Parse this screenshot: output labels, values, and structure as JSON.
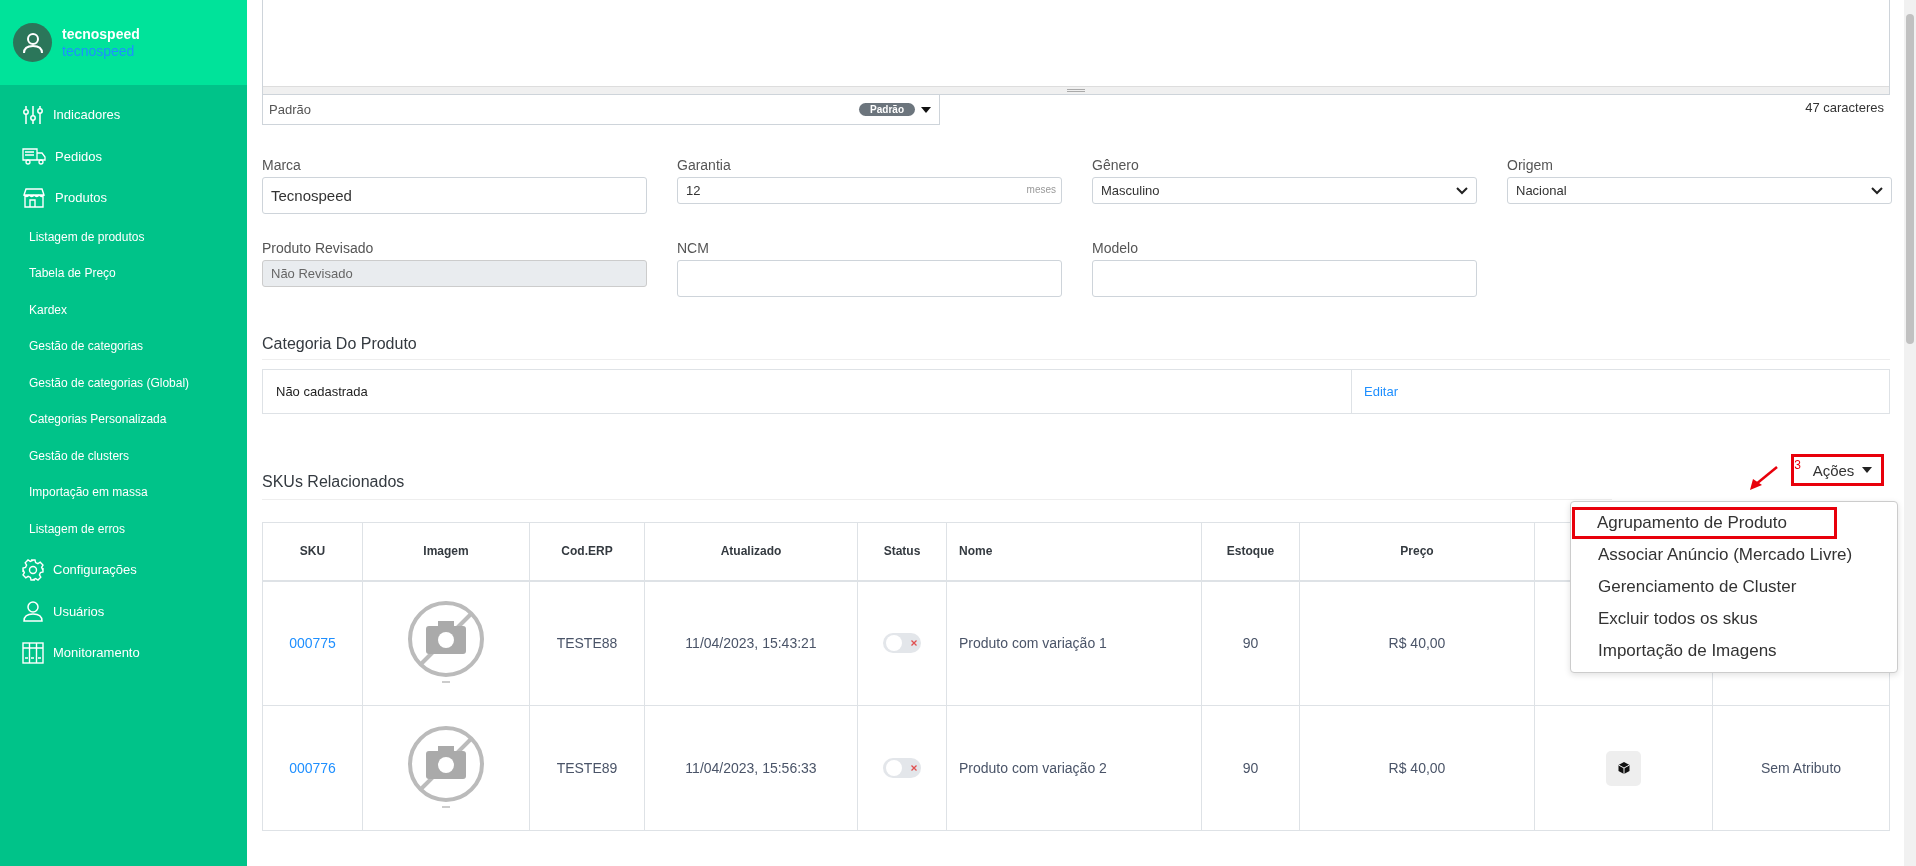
{
  "user": {
    "name": "tecnospeed",
    "company": "tecnospeed"
  },
  "sidebar": {
    "items": [
      {
        "label": "Indicadores"
      },
      {
        "label": "Pedidos"
      },
      {
        "label": "Produtos",
        "children": [
          {
            "label": "Listagem de produtos"
          },
          {
            "label": "Tabela de Preço"
          },
          {
            "label": "Kardex"
          },
          {
            "label": "Gestão de categorias"
          },
          {
            "label": "Gestão de categorias (Global)"
          },
          {
            "label": "Categorias Personalizada"
          },
          {
            "label": "Gestão de clusters"
          },
          {
            "label": "Importação em massa"
          },
          {
            "label": "Listagem de erros"
          }
        ]
      },
      {
        "label": "Configurações"
      },
      {
        "label": "Usuários"
      },
      {
        "label": "Monitoramento"
      }
    ]
  },
  "description": {
    "template": {
      "value": "Padrão",
      "badge": "Padrão"
    },
    "char_count": "47 caracteres"
  },
  "fields": [
    {
      "label": "Marca",
      "value": "Tecnospeed",
      "kind": "text",
      "disabled": false
    },
    {
      "label": "Garantia",
      "value": "12",
      "suffix": "meses",
      "kind": "text",
      "disabled": false
    },
    {
      "label": "Gênero",
      "value": "Masculino",
      "kind": "select",
      "disabled": false
    },
    {
      "label": "Origem",
      "value": "Nacional",
      "kind": "select",
      "disabled": false
    },
    {
      "label": "Produto Revisado",
      "value": "Não Revisado",
      "kind": "text",
      "disabled": true
    },
    {
      "label": "NCM",
      "kind": "text",
      "disabled": false
    },
    {
      "label": "Modelo",
      "kind": "text",
      "disabled": false
    }
  ],
  "category": {
    "title": "Categoria Do Produto",
    "value": "Não cadastrada",
    "action": "Editar"
  },
  "skus": {
    "title": "SKUs Relacionados",
    "actions_button": "Ações",
    "annotation_number": "3",
    "menu": [
      {
        "label": "Agrupamento de Produto",
        "highlighted": true
      },
      {
        "label": "Associar Anúncio (Mercado Livre)",
        "highlighted": false
      },
      {
        "label": "Gerenciamento de Cluster",
        "highlighted": false
      },
      {
        "label": "Excluir todos os skus",
        "highlighted": false
      },
      {
        "label": "Importação de Imagens",
        "highlighted": false
      }
    ],
    "table": {
      "columns": [
        "SKU",
        "Imagem",
        "Cod.ERP",
        "Atualizado",
        "Status",
        "Nome",
        "Estoque",
        "Preço"
      ],
      "rows": [
        {
          "sku": "000775",
          "cod_erp": "TESTE88",
          "updated": "11/04/2023, 15:43:21",
          "status_on": false,
          "name": "Produto com variação 1",
          "stock": "90",
          "price": "R$ 40,00",
          "cluster_button": false
        },
        {
          "sku": "000776",
          "cod_erp": "TESTE89",
          "updated": "11/04/2023, 15:56:33",
          "status_on": false,
          "name": "Produto com variação 2",
          "stock": "90",
          "price": "R$ 40,00",
          "cluster_button": true,
          "column_10": "Sem Atributo"
        }
      ]
    }
  }
}
